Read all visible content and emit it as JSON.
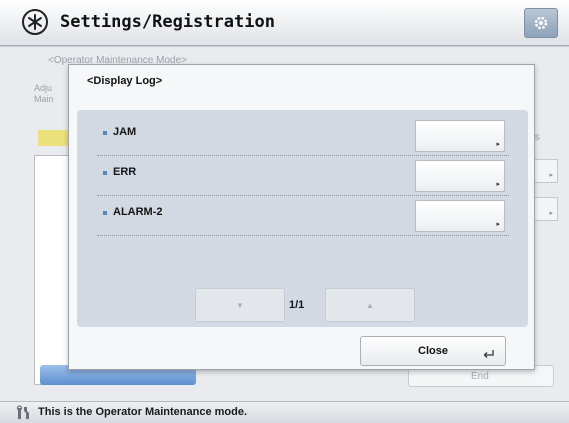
{
  "header": {
    "title": "Settings/Registration",
    "title_icon": "settings-registration-icon",
    "gear_icon": "gear-icon"
  },
  "background": {
    "breadcrumb": "<Operator Maintenance Mode>",
    "menu_label_line1": "Adju",
    "menu_label_line2": "Main",
    "right_text": "ts",
    "end_button": "End"
  },
  "dialog": {
    "title": "<Display Log>",
    "rows": [
      {
        "label": "JAM"
      },
      {
        "label": "ERR"
      },
      {
        "label": "ALARM-2"
      }
    ],
    "pager": {
      "page": "1/1",
      "down_icon": "down-arrow-icon",
      "up_icon": "up-arrow-icon"
    },
    "close_label": "Close"
  },
  "status": {
    "text": "This is the Operator Maintenance mode.",
    "icon": "wrench-icon"
  },
  "colors": {
    "accent_blue": "#5f8fcf",
    "panel": "#d3d9e2",
    "bullet": "#5b84b8"
  }
}
